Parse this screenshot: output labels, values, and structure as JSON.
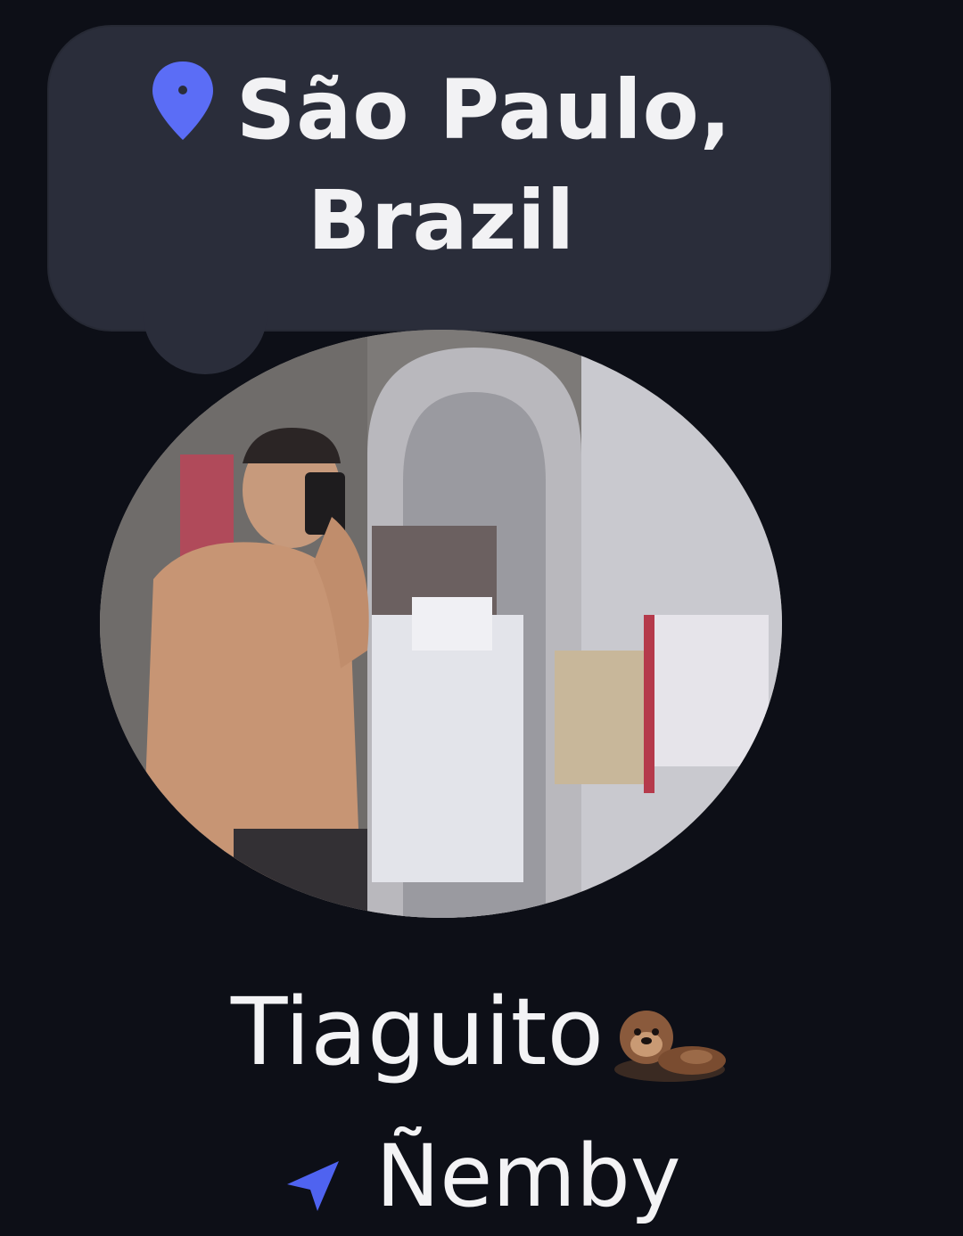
{
  "location_bubble": {
    "line1": "São Paulo,",
    "line2": "Brazil",
    "pin_icon": "map-pin-icon",
    "pin_color": "#5b6df6",
    "background_color": "#2a2d3a"
  },
  "profile": {
    "name": "Tiaguito",
    "emoji_icon": "otter-icon",
    "location_label": "Ñemby",
    "location_icon": "navigation-arrow-icon",
    "location_icon_color": "#4f63f0"
  },
  "colors": {
    "background": "#0d0f17",
    "text": "#f2f2f4"
  }
}
